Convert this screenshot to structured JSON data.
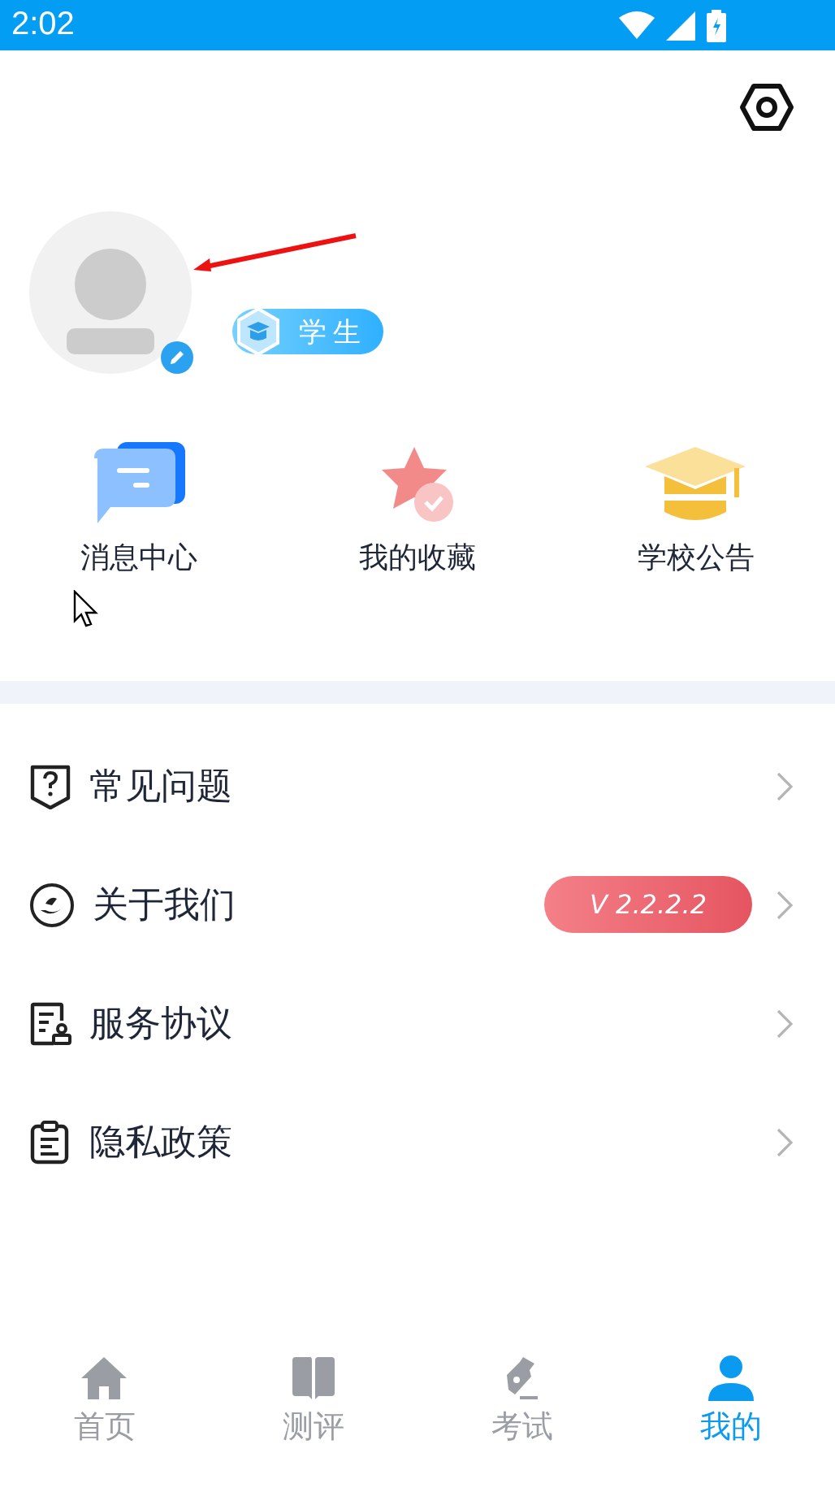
{
  "status_bar": {
    "time": "2:02"
  },
  "profile": {
    "role_badge": "学生"
  },
  "shortcuts": [
    {
      "kind": "message",
      "label": "消息中心"
    },
    {
      "kind": "favorite",
      "label": "我的收藏"
    },
    {
      "kind": "notice",
      "label": "学校公告"
    }
  ],
  "menu": [
    {
      "kind": "help",
      "label": "常见问题"
    },
    {
      "kind": "about",
      "label": "关于我们",
      "badge": "V 2.2.2.2"
    },
    {
      "kind": "service",
      "label": "服务协议"
    },
    {
      "kind": "privacy",
      "label": "隐私政策"
    }
  ],
  "tab_bar": [
    {
      "kind": "home",
      "label": "首页",
      "selected": false
    },
    {
      "kind": "review",
      "label": "测评",
      "selected": false
    },
    {
      "kind": "exam",
      "label": "考试",
      "selected": false
    },
    {
      "kind": "me",
      "label": "我的",
      "selected": true
    }
  ]
}
